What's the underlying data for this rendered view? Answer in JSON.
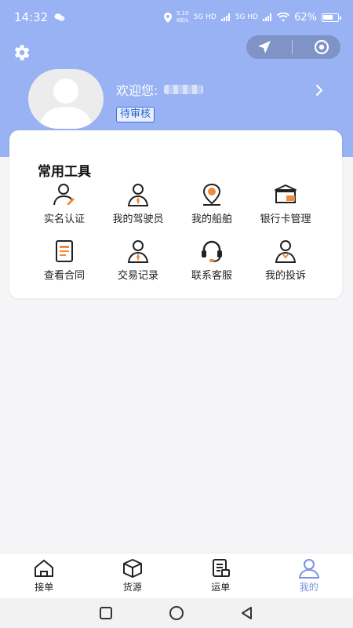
{
  "status_bar": {
    "time": "14:32",
    "net_speed_value": "5.10",
    "net_speed_unit": "KB/s",
    "sim1": "5G HD",
    "sim2": "5G HD",
    "battery": "62%"
  },
  "header": {
    "welcome_label": "欢迎您:",
    "review_badge": "待审核"
  },
  "tools": {
    "title": "常用工具",
    "items": [
      {
        "label": "实名认证",
        "icon": "id-verify-icon"
      },
      {
        "label": "我的驾驶员",
        "icon": "driver-icon"
      },
      {
        "label": "我的船舶",
        "icon": "ship-location-icon"
      },
      {
        "label": "银行卡管理",
        "icon": "bank-card-icon"
      },
      {
        "label": "查看合同",
        "icon": "contract-icon"
      },
      {
        "label": "交易记录",
        "icon": "transaction-icon"
      },
      {
        "label": "联系客服",
        "icon": "headset-icon"
      },
      {
        "label": "我的投诉",
        "icon": "complaint-icon"
      }
    ]
  },
  "bottom_nav": {
    "items": [
      {
        "label": "接单",
        "icon": "home-icon"
      },
      {
        "label": "货源",
        "icon": "box-icon"
      },
      {
        "label": "运单",
        "icon": "waybill-icon"
      },
      {
        "label": "我的",
        "icon": "user-icon",
        "active": true
      }
    ]
  },
  "colors": {
    "header_bg": "#98b2f4",
    "accent": "#3a6fdc",
    "icon_orange": "#f08a3c",
    "active_nav": "#7a93e0"
  }
}
